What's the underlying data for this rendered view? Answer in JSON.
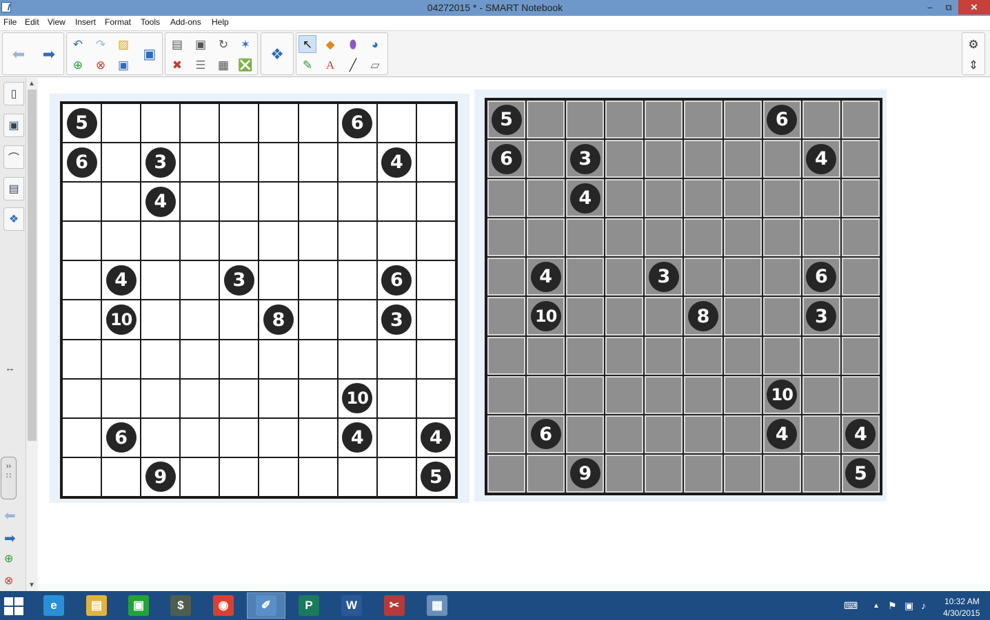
{
  "window": {
    "title": "04272015 * - SMART Notebook",
    "minimize": "–",
    "maximize": "⧉",
    "close": "✕"
  },
  "menu": [
    "File",
    "Edit",
    "View",
    "Insert",
    "Format",
    "Tools",
    "Add-ons",
    "Help"
  ],
  "toolbar": {
    "icons": [
      "back-arrow-icon",
      "forward-arrow-icon",
      "undo-icon",
      "redo-icon",
      "add-page-icon",
      "delete-page-icon",
      "open-folder-icon",
      "save-icon",
      "screen-shade-icon",
      "paste-icon",
      "delete-icon",
      "screen-capture-icon",
      "show-hide-icon",
      "rotate-icon",
      "table-icon",
      "magic-pen-icon",
      "clear-icon",
      "add-ons-icon",
      "select-icon",
      "pens-icon",
      "shapes-icon",
      "text-icon",
      "line-icon",
      "eraser-icon",
      "fill-icon",
      "settings-icon",
      "move-toolbar-icon"
    ]
  },
  "sidebar": {
    "tabs": [
      "page-sorter-icon",
      "gallery-icon",
      "attachments-icon",
      "properties-icon",
      "add-ons-icon"
    ],
    "resize": "↔",
    "handle": "››"
  },
  "puzzle_left": {
    "rows": [
      [
        "5",
        "",
        "",
        "",
        "",
        "",
        "",
        "6",
        "",
        ""
      ],
      [
        "6",
        "",
        "3",
        "",
        "",
        "",
        "",
        "",
        "4",
        ""
      ],
      [
        "",
        "",
        "4",
        "",
        "",
        "",
        "",
        "",
        "",
        ""
      ],
      [
        "",
        "",
        "",
        "",
        "",
        "",
        "",
        "",
        "",
        ""
      ],
      [
        "",
        "4",
        "",
        "",
        "3",
        "",
        "",
        "",
        "6",
        ""
      ],
      [
        "",
        "10",
        "",
        "",
        "",
        "8",
        "",
        "",
        "3",
        ""
      ],
      [
        "",
        "",
        "",
        "",
        "",
        "",
        "",
        "",
        "",
        ""
      ],
      [
        "",
        "",
        "",
        "",
        "",
        "",
        "",
        "10",
        "",
        ""
      ],
      [
        "",
        "6",
        "",
        "",
        "",
        "",
        "",
        "4",
        "",
        "4"
      ],
      [
        "",
        "",
        "9",
        "",
        "",
        "",
        "",
        "",
        "",
        "5"
      ]
    ]
  },
  "puzzle_right": {
    "rows": [
      [
        "5",
        "",
        "",
        "",
        "",
        "",
        "",
        "6",
        "",
        ""
      ],
      [
        "6",
        "",
        "3",
        "",
        "",
        "",
        "",
        "",
        "4",
        ""
      ],
      [
        "",
        "",
        "4",
        "",
        "",
        "",
        "",
        "",
        "",
        ""
      ],
      [
        "",
        "",
        "",
        "",
        "",
        "",
        "",
        "",
        "",
        ""
      ],
      [
        "",
        "4",
        "",
        "",
        "3",
        "",
        "",
        "",
        "6",
        ""
      ],
      [
        "",
        "10",
        "",
        "",
        "",
        "8",
        "",
        "",
        "3",
        ""
      ],
      [
        "",
        "",
        "",
        "",
        "",
        "",
        "",
        "",
        "",
        ""
      ],
      [
        "",
        "",
        "",
        "",
        "",
        "",
        "",
        "10",
        "",
        ""
      ],
      [
        "",
        "6",
        "",
        "",
        "",
        "",
        "",
        "4",
        "",
        "4"
      ],
      [
        "",
        "",
        "9",
        "",
        "",
        "",
        "",
        "",
        "",
        "5"
      ]
    ]
  },
  "taskbar": {
    "apps": [
      {
        "name": "internet-explorer",
        "glyph": "e",
        "color": "#2b8fd6"
      },
      {
        "name": "file-explorer",
        "glyph": "▤",
        "color": "#e2b33c"
      },
      {
        "name": "store",
        "glyph": "▣",
        "color": "#22a33a"
      },
      {
        "name": "money-app",
        "glyph": "$",
        "color": "#4e5e4e"
      },
      {
        "name": "chrome",
        "glyph": "◉",
        "color": "#d9412f"
      },
      {
        "name": "smart-notebook",
        "glyph": "✐",
        "color": "#5b8fc9"
      },
      {
        "name": "publisher",
        "glyph": "P",
        "color": "#1a7a5c"
      },
      {
        "name": "word",
        "glyph": "W",
        "color": "#2b5797"
      },
      {
        "name": "snipping-tool",
        "glyph": "✂",
        "color": "#b53a3a"
      },
      {
        "name": "calculator",
        "glyph": "▦",
        "color": "#6a8fb8"
      }
    ],
    "time": "10:32 AM",
    "date": "4/30/2015"
  }
}
